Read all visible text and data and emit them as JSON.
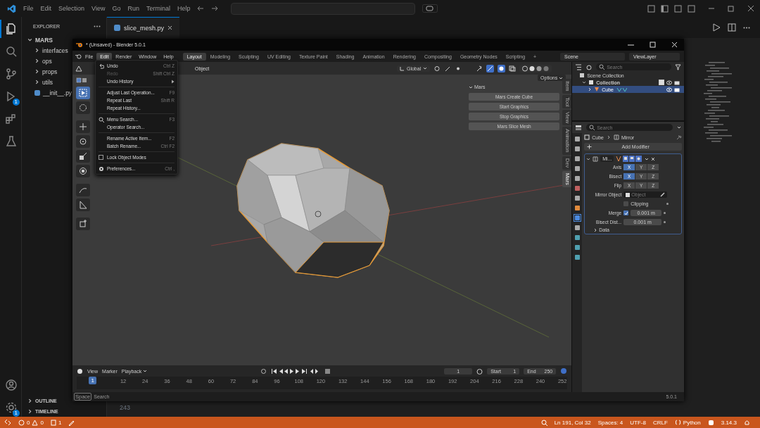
{
  "vscode": {
    "menu": [
      "File",
      "Edit",
      "Selection",
      "View",
      "Go",
      "Run",
      "Terminal",
      "Help"
    ],
    "activity": [
      {
        "kind": "files",
        "selected": true
      },
      {
        "kind": "search",
        "selected": false
      },
      {
        "kind": "source-control",
        "selected": false
      },
      {
        "kind": "debug",
        "selected": false,
        "badge": "1"
      },
      {
        "kind": "extensions",
        "selected": false
      },
      {
        "kind": "testing",
        "selected": false
      }
    ],
    "activity_bottom": [
      {
        "kind": "account"
      },
      {
        "kind": "settings",
        "badge": "1"
      }
    ],
    "explorer": {
      "title": "EXPLORER",
      "root": {
        "label": "MARS",
        "expanded": true,
        "children": [
          {
            "label": "interfaces",
            "kind": "folder",
            "expanded": false
          },
          {
            "label": "ops",
            "kind": "folder",
            "expanded": false
          },
          {
            "label": "props",
            "kind": "folder",
            "expanded": false
          },
          {
            "label": "utils",
            "kind": "folder",
            "expanded": false
          },
          {
            "label": "__init__.py",
            "kind": "file"
          }
        ]
      }
    },
    "sections": [
      {
        "label": "OUTLINE",
        "expanded": false
      },
      {
        "label": "TIMELINE",
        "expanded": false
      }
    ],
    "tabs": [
      {
        "label": "slice_mesh.py",
        "selected": true
      }
    ],
    "line_number": "243",
    "status_bar": {
      "errors": "0",
      "warnings": "0",
      "ports": "1",
      "items": [
        "Ln 191, Col 32",
        "Spaces: 4",
        "UTF-8",
        "CRLF"
      ],
      "language": "Python",
      "version": "3.14.3"
    }
  },
  "blender": {
    "title": "* (Unsaved) - Blender 5.0.1",
    "menu": [
      {
        "label": "File",
        "selected": false
      },
      {
        "label": "Edit",
        "selected": true
      },
      {
        "label": "Render",
        "selected": false
      },
      {
        "label": "Window",
        "selected": false
      },
      {
        "label": "Help",
        "selected": false
      }
    ],
    "workspaces": [
      {
        "label": "Layout",
        "selected": true
      },
      {
        "label": "Modeling",
        "selected": false
      },
      {
        "label": "Sculpting",
        "selected": false
      },
      {
        "label": "UV Editing",
        "selected": false
      },
      {
        "label": "Texture Paint",
        "selected": false
      },
      {
        "label": "Shading",
        "selected": false
      },
      {
        "label": "Animation",
        "selected": false
      },
      {
        "label": "Rendering",
        "selected": false
      },
      {
        "label": "Compositing",
        "selected": false
      },
      {
        "label": "Geometry Nodes",
        "selected": false
      },
      {
        "label": "Scripting",
        "selected": false
      }
    ],
    "add_workspace": "+",
    "scene": "Scene",
    "view_layer": "ViewLayer",
    "viewport": {
      "object_menu": "Object",
      "orientation": "Global",
      "options": "Options"
    },
    "n_panel": {
      "title": "Mars",
      "buttons": [
        "Mars Create Cube",
        "Start Graphics",
        "Stop Graphics",
        "Mars Slice Mesh"
      ],
      "tabs": [
        {
          "label": "Item",
          "selected": false
        },
        {
          "label": "Tool",
          "selected": false
        },
        {
          "label": "View",
          "selected": false
        },
        {
          "label": "Animation",
          "selected": false
        },
        {
          "label": "Dev",
          "selected": false
        },
        {
          "label": "Mars",
          "selected": true
        }
      ]
    },
    "edit_menu": [
      {
        "kind": "item",
        "label": "Undo",
        "shortcut": "Ctrl Z",
        "disabled": false
      },
      {
        "kind": "item",
        "label": "Redo",
        "shortcut": "Shift Ctrl Z",
        "disabled": true
      },
      {
        "kind": "submenu",
        "label": "Undo History",
        "disabled": false
      },
      {
        "kind": "separator"
      },
      {
        "kind": "item",
        "label": "Adjust Last Operation...",
        "shortcut": "F9",
        "disabled": false
      },
      {
        "kind": "item",
        "label": "Repeat Last",
        "shortcut": "Shift R",
        "disabled": false
      },
      {
        "kind": "item",
        "label": "Repeat History...",
        "disabled": false
      },
      {
        "kind": "separator"
      },
      {
        "kind": "item",
        "label": "Menu Search...",
        "shortcut": "F3",
        "disabled": false
      },
      {
        "kind": "item",
        "label": "Operator Search...",
        "disabled": false
      },
      {
        "kind": "separator"
      },
      {
        "kind": "item",
        "label": "Rename Active Item...",
        "shortcut": "F2",
        "disabled": false
      },
      {
        "kind": "item",
        "label": "Batch Rename...",
        "shortcut": "Ctrl F2",
        "disabled": false
      },
      {
        "kind": "separator"
      },
      {
        "kind": "checkbox",
        "label": "Lock Object Modes",
        "checked": false
      },
      {
        "kind": "separator"
      },
      {
        "kind": "item",
        "label": "Preferences...",
        "shortcut": "Ctrl ,",
        "disabled": false
      }
    ],
    "timeline": {
      "menus": [
        "View",
        "Marker",
        "Playback"
      ],
      "current_frame": "1",
      "start_label": "Start",
      "start": "1",
      "end_label": "End",
      "end": "250",
      "playhead": "1",
      "ticks": [
        "12",
        "24",
        "36",
        "48",
        "60",
        "72",
        "84",
        "96",
        "108",
        "120",
        "132",
        "144",
        "156",
        "168",
        "180",
        "192",
        "204",
        "216",
        "228",
        "240",
        "252"
      ]
    },
    "outliner": {
      "search_placeholder": "Search",
      "label": "Scene Collection",
      "children": [
        {
          "label": "Collection",
          "checked": true,
          "selected": false,
          "children": [
            {
              "label": "Cube",
              "selected": true
            }
          ]
        }
      ]
    },
    "properties": {
      "search_placeholder": "Search",
      "breadcrumb": [
        "Cube",
        "Mirror"
      ],
      "add_modifier": "Add Modifier",
      "modifier_name": "Mi...",
      "rows": [
        {
          "label": "Axis",
          "options": [
            {
              "label": "X",
              "selected": true
            },
            {
              "label": "Y",
              "selected": false
            },
            {
              "label": "Z",
              "selected": false
            }
          ]
        },
        {
          "label": "Bisect",
          "options": [
            {
              "label": "X",
              "selected": true
            },
            {
              "label": "Y",
              "selected": false
            },
            {
              "label": "Z",
              "selected": false
            }
          ]
        },
        {
          "label": "Flip",
          "options": [
            {
              "label": "X",
              "selected": false
            },
            {
              "label": "Y",
              "selected": false
            },
            {
              "label": "Z",
              "selected": false
            }
          ]
        }
      ],
      "mirror_object": {
        "label": "Mirror Object",
        "placeholder": "Object"
      },
      "clipping": {
        "label": "Clipping",
        "checked": false
      },
      "merge": {
        "label": "Merge",
        "checked": true,
        "value": "0.001 m"
      },
      "bisect_distance": {
        "label": "Bisect Dist...",
        "value": "0.001 m"
      },
      "subpanel": {
        "label": "Data",
        "expanded": false
      }
    },
    "status": {
      "key": "Space",
      "action": "Search",
      "version": "5.0.1"
    }
  }
}
